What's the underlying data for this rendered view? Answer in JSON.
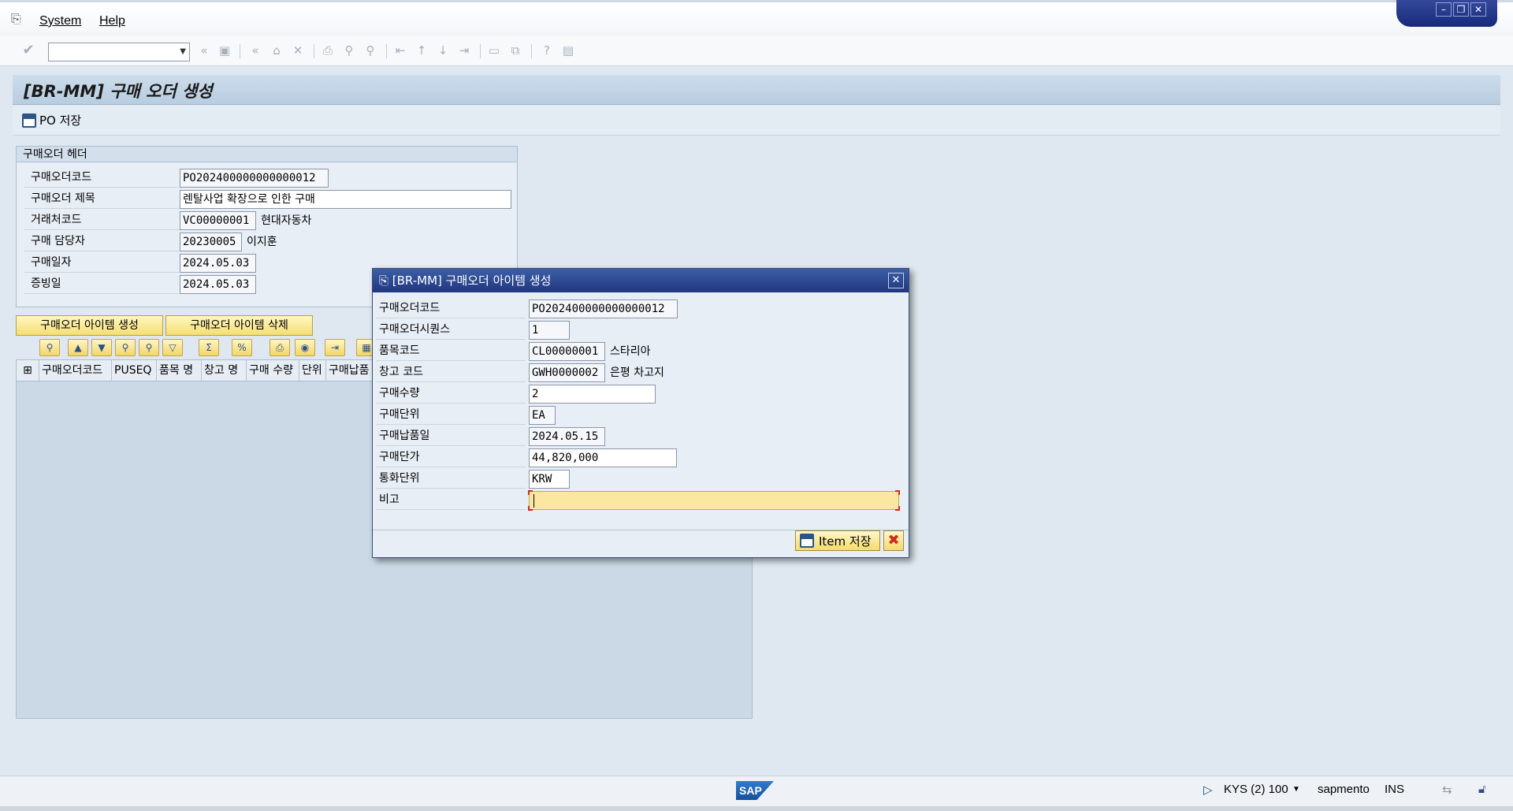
{
  "menu": {
    "system": "System",
    "help": "Help"
  },
  "window_controls": {
    "minimize": "–",
    "restore": "❐",
    "close": "✕"
  },
  "toolbar": {
    "command_value": "",
    "icons": [
      "enter-icon",
      "save-icon",
      "back-icon",
      "exit-icon",
      "cancel-icon",
      "print-icon",
      "find-icon",
      "find-next-icon",
      "first-page-icon",
      "previous-page-icon",
      "next-page-icon",
      "last-page-icon",
      "new-session-icon",
      "shortcut-icon",
      "help-icon",
      "layout-icon"
    ]
  },
  "page": {
    "title": "[BR-MM] 구매 오더 생성",
    "po_save_label": "PO 저장"
  },
  "header_box": {
    "title": "구매오더 헤더",
    "rows": [
      {
        "label": "구매오더코드",
        "value": "PO202400000000000012",
        "desc": ""
      },
      {
        "label": "구매오더 제목",
        "value": "렌탈사업 확장으로 인한 구매",
        "desc": ""
      },
      {
        "label": "거래처코드",
        "value": "VC00000001",
        "desc": "현대자동차"
      },
      {
        "label": "구매 담당자",
        "value": "20230005",
        "desc": "이지훈"
      },
      {
        "label": "구매일자",
        "value": "2024.05.03",
        "desc": ""
      },
      {
        "label": "증빙일",
        "value": "2024.05.03",
        "desc": ""
      }
    ]
  },
  "grid": {
    "create_item_label": "구매오더 아이템 생성",
    "delete_item_label": "구매오더 아이템 삭제",
    "columns": [
      "구매오더코드",
      "PUSEQ",
      "품목 명",
      "창고 명",
      "구매 수량",
      "단위",
      "구매납품"
    ]
  },
  "dialog": {
    "title": "[BR-MM] 구매오더 아이템 생성",
    "rows": [
      {
        "label": "구매오더코드",
        "value": "PO202400000000000012",
        "desc": ""
      },
      {
        "label": "구매오더시퀀스",
        "value": "1",
        "desc": ""
      },
      {
        "label": "품목코드",
        "value": "CL00000001",
        "desc": "스타리아"
      },
      {
        "label": "창고 코드",
        "value": "GWH0000002",
        "desc": "은평 차고지"
      },
      {
        "label": "구매수량",
        "value": "2",
        "desc": ""
      },
      {
        "label": "구매단위",
        "value": "EA",
        "desc": ""
      },
      {
        "label": "구매납품일",
        "value": "2024.05.15",
        "desc": ""
      },
      {
        "label": "구매단가",
        "value": "44,820,000",
        "desc": ""
      },
      {
        "label": "통화단위",
        "value": "KRW",
        "desc": ""
      },
      {
        "label": "비고",
        "value": "",
        "desc": ""
      }
    ],
    "save_label": "Item 저장"
  },
  "statusbar": {
    "logo": "SAP",
    "system": "KYS (2) 100",
    "server": "sapmento",
    "mode": "INS"
  }
}
